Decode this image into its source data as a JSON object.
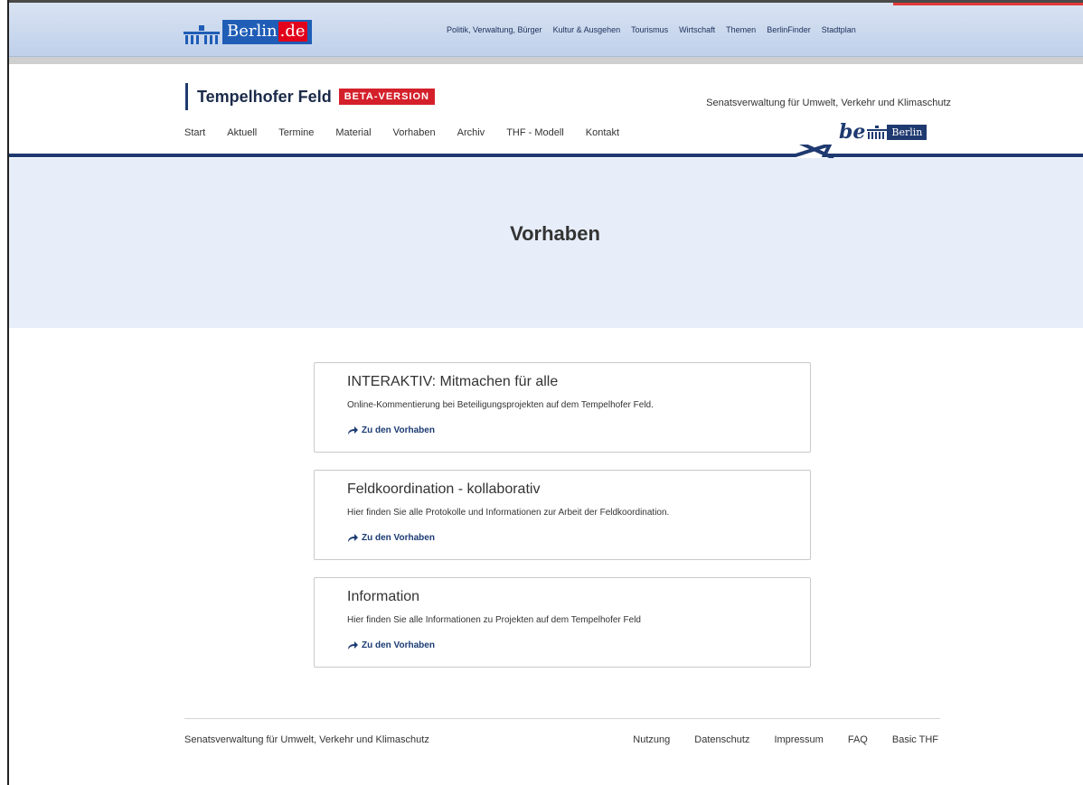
{
  "portal": {
    "logo_text": "Berlin",
    "logo_tld": ".de",
    "nav": [
      "Politik, Verwaltung, Bürger",
      "Kultur & Ausgehen",
      "Tourismus",
      "Wirtschaft",
      "Themen",
      "BerlinFinder",
      "Stadtplan"
    ]
  },
  "site": {
    "title": "Tempelhofer Feld",
    "badge": "BETA-VERSION",
    "department": "Senatsverwaltung für Umwelt, Verkehr und Klimaschutz",
    "be_text": "be",
    "be_box": "Berlin",
    "nav": [
      "Start",
      "Aktuell",
      "Termine",
      "Material",
      "Vorhaben",
      "Archiv",
      "THF - Modell",
      "Kontakt"
    ]
  },
  "hero": {
    "title": "Vorhaben"
  },
  "cards": [
    {
      "title": "INTERAKTIV: Mitmachen für alle",
      "description": "Online-Kommentierung bei Beteiligungsprojekten auf dem Tempelhofer Feld.",
      "link": "Zu den Vorhaben"
    },
    {
      "title": "Feldkoordination - kollaborativ",
      "description": "Hier finden Sie alle Protokolle und Informationen zur Arbeit der Feldkoordination.",
      "link": "Zu den Vorhaben"
    },
    {
      "title": "Information",
      "description": "Hier finden Sie alle Informationen zu Projekten auf dem Tempelhofer Feld",
      "link": "Zu den Vorhaben"
    }
  ],
  "footer": {
    "org": "Senatsverwaltung für Umwelt, Verkehr und Klimaschutz",
    "links": [
      "Nutzung",
      "Datenschutz",
      "Impressum",
      "FAQ",
      "Basic THF"
    ]
  },
  "colors": {
    "brand_blue": "#1f5db6",
    "brand_red": "#e2001a",
    "navy": "#1f3a70",
    "hero_bg": "#e7eef9"
  }
}
